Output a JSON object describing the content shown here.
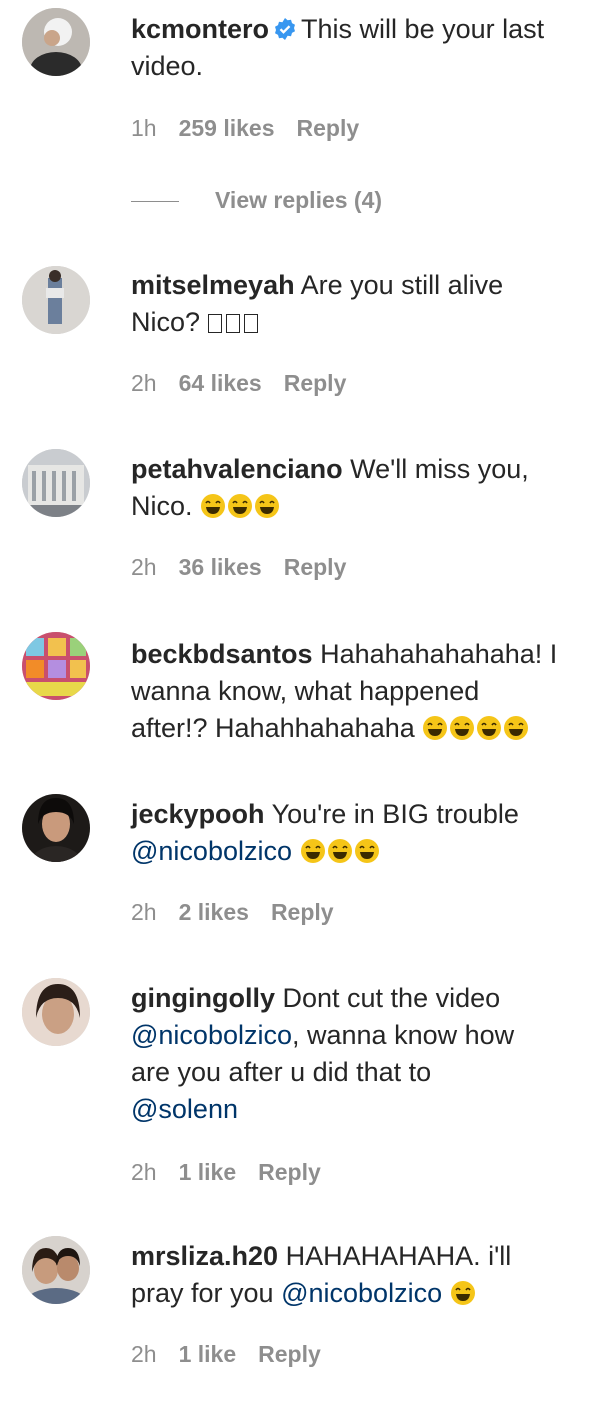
{
  "comments": [
    {
      "username": "kcmontero",
      "verified": true,
      "text_lines": [
        "This will be your last",
        "video."
      ],
      "time": "1h",
      "likes": "259 likes",
      "reply": "Reply",
      "view_replies": "View replies (4)"
    },
    {
      "username": "mitselmeyah",
      "text": "Are you still alive",
      "line2": "Nico?",
      "time": "2h",
      "likes": "64 likes",
      "reply": "Reply"
    },
    {
      "username": "petahvalenciano",
      "text": "We'll miss you,",
      "line2": "Nico.",
      "time": "2h",
      "likes": "36 likes",
      "reply": "Reply"
    },
    {
      "username": "beckbdsantos",
      "text": "Hahahahahahaha! I",
      "line2": "wanna know, what happened",
      "line3": "after!? Hahahhahahaha"
    },
    {
      "username": "jeckypooh",
      "text": "You're in BIG trouble",
      "mention": "@nicobolzico",
      "time": "2h",
      "likes": "2 likes",
      "reply": "Reply"
    },
    {
      "username": "gingingolly",
      "text": "Dont cut the video",
      "mention": "@nicobolzico",
      "line2": ", wanna know how",
      "line3": "are you after u did that to",
      "mention2": "@solenn",
      "time": "2h",
      "likes": "1 like",
      "reply": "Reply"
    },
    {
      "username": "mrsliza.h20",
      "text": "HAHAHAHAHA. i'll",
      "line2": "pray for you",
      "mention": "@nicobolzico",
      "time": "2h",
      "likes": "1 like",
      "reply": "Reply"
    }
  ],
  "colors": {
    "text": "#262626",
    "meta": "#8e8e8e",
    "mention": "#003569",
    "verified": "#3897f0",
    "emoji": "#f5c518"
  }
}
